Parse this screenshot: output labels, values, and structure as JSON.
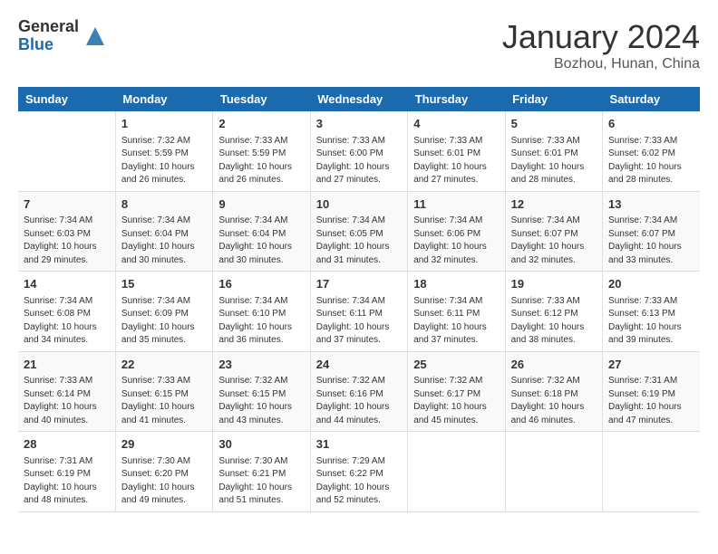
{
  "header": {
    "logo_general": "General",
    "logo_blue": "Blue",
    "month_year": "January 2024",
    "location": "Bozhou, Hunan, China"
  },
  "days_of_week": [
    "Sunday",
    "Monday",
    "Tuesday",
    "Wednesday",
    "Thursday",
    "Friday",
    "Saturday"
  ],
  "weeks": [
    [
      {
        "day": "",
        "content": ""
      },
      {
        "day": "1",
        "content": "Sunrise: 7:32 AM\nSunset: 5:59 PM\nDaylight: 10 hours\nand 26 minutes."
      },
      {
        "day": "2",
        "content": "Sunrise: 7:33 AM\nSunset: 5:59 PM\nDaylight: 10 hours\nand 26 minutes."
      },
      {
        "day": "3",
        "content": "Sunrise: 7:33 AM\nSunset: 6:00 PM\nDaylight: 10 hours\nand 27 minutes."
      },
      {
        "day": "4",
        "content": "Sunrise: 7:33 AM\nSunset: 6:01 PM\nDaylight: 10 hours\nand 27 minutes."
      },
      {
        "day": "5",
        "content": "Sunrise: 7:33 AM\nSunset: 6:01 PM\nDaylight: 10 hours\nand 28 minutes."
      },
      {
        "day": "6",
        "content": "Sunrise: 7:33 AM\nSunset: 6:02 PM\nDaylight: 10 hours\nand 28 minutes."
      }
    ],
    [
      {
        "day": "7",
        "content": "Sunrise: 7:34 AM\nSunset: 6:03 PM\nDaylight: 10 hours\nand 29 minutes."
      },
      {
        "day": "8",
        "content": "Sunrise: 7:34 AM\nSunset: 6:04 PM\nDaylight: 10 hours\nand 30 minutes."
      },
      {
        "day": "9",
        "content": "Sunrise: 7:34 AM\nSunset: 6:04 PM\nDaylight: 10 hours\nand 30 minutes."
      },
      {
        "day": "10",
        "content": "Sunrise: 7:34 AM\nSunset: 6:05 PM\nDaylight: 10 hours\nand 31 minutes."
      },
      {
        "day": "11",
        "content": "Sunrise: 7:34 AM\nSunset: 6:06 PM\nDaylight: 10 hours\nand 32 minutes."
      },
      {
        "day": "12",
        "content": "Sunrise: 7:34 AM\nSunset: 6:07 PM\nDaylight: 10 hours\nand 32 minutes."
      },
      {
        "day": "13",
        "content": "Sunrise: 7:34 AM\nSunset: 6:07 PM\nDaylight: 10 hours\nand 33 minutes."
      }
    ],
    [
      {
        "day": "14",
        "content": "Sunrise: 7:34 AM\nSunset: 6:08 PM\nDaylight: 10 hours\nand 34 minutes."
      },
      {
        "day": "15",
        "content": "Sunrise: 7:34 AM\nSunset: 6:09 PM\nDaylight: 10 hours\nand 35 minutes."
      },
      {
        "day": "16",
        "content": "Sunrise: 7:34 AM\nSunset: 6:10 PM\nDaylight: 10 hours\nand 36 minutes."
      },
      {
        "day": "17",
        "content": "Sunrise: 7:34 AM\nSunset: 6:11 PM\nDaylight: 10 hours\nand 37 minutes."
      },
      {
        "day": "18",
        "content": "Sunrise: 7:34 AM\nSunset: 6:11 PM\nDaylight: 10 hours\nand 37 minutes."
      },
      {
        "day": "19",
        "content": "Sunrise: 7:33 AM\nSunset: 6:12 PM\nDaylight: 10 hours\nand 38 minutes."
      },
      {
        "day": "20",
        "content": "Sunrise: 7:33 AM\nSunset: 6:13 PM\nDaylight: 10 hours\nand 39 minutes."
      }
    ],
    [
      {
        "day": "21",
        "content": "Sunrise: 7:33 AM\nSunset: 6:14 PM\nDaylight: 10 hours\nand 40 minutes."
      },
      {
        "day": "22",
        "content": "Sunrise: 7:33 AM\nSunset: 6:15 PM\nDaylight: 10 hours\nand 41 minutes."
      },
      {
        "day": "23",
        "content": "Sunrise: 7:32 AM\nSunset: 6:15 PM\nDaylight: 10 hours\nand 43 minutes."
      },
      {
        "day": "24",
        "content": "Sunrise: 7:32 AM\nSunset: 6:16 PM\nDaylight: 10 hours\nand 44 minutes."
      },
      {
        "day": "25",
        "content": "Sunrise: 7:32 AM\nSunset: 6:17 PM\nDaylight: 10 hours\nand 45 minutes."
      },
      {
        "day": "26",
        "content": "Sunrise: 7:32 AM\nSunset: 6:18 PM\nDaylight: 10 hours\nand 46 minutes."
      },
      {
        "day": "27",
        "content": "Sunrise: 7:31 AM\nSunset: 6:19 PM\nDaylight: 10 hours\nand 47 minutes."
      }
    ],
    [
      {
        "day": "28",
        "content": "Sunrise: 7:31 AM\nSunset: 6:19 PM\nDaylight: 10 hours\nand 48 minutes."
      },
      {
        "day": "29",
        "content": "Sunrise: 7:30 AM\nSunset: 6:20 PM\nDaylight: 10 hours\nand 49 minutes."
      },
      {
        "day": "30",
        "content": "Sunrise: 7:30 AM\nSunset: 6:21 PM\nDaylight: 10 hours\nand 51 minutes."
      },
      {
        "day": "31",
        "content": "Sunrise: 7:29 AM\nSunset: 6:22 PM\nDaylight: 10 hours\nand 52 minutes."
      },
      {
        "day": "",
        "content": ""
      },
      {
        "day": "",
        "content": ""
      },
      {
        "day": "",
        "content": ""
      }
    ]
  ]
}
